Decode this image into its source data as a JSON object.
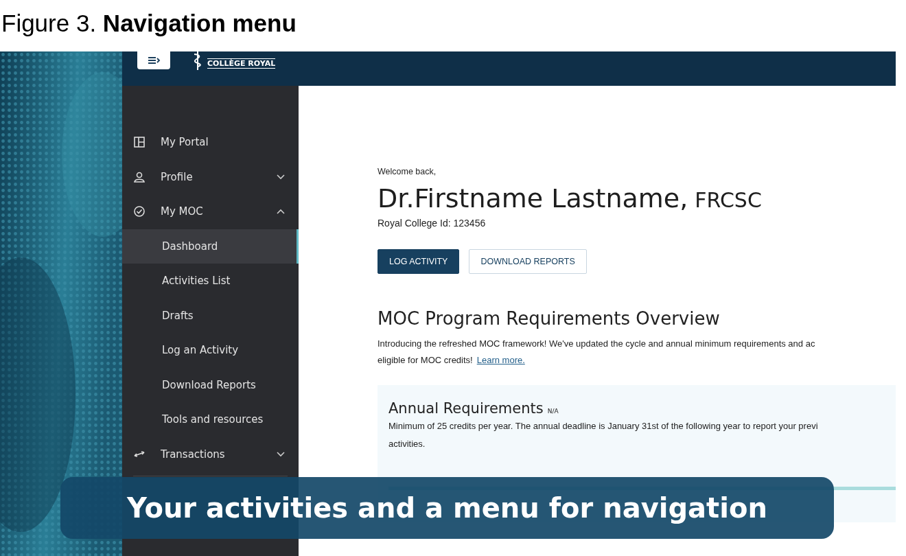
{
  "figure_caption": {
    "label": "Figure 3.",
    "title": "Navigation menu"
  },
  "header": {
    "logo_text": "COLLÈGE ROYAL"
  },
  "sidebar": {
    "items": [
      {
        "kind": "item",
        "label": "My Portal",
        "selected": false
      },
      {
        "kind": "group",
        "label": "Profile",
        "expanded": false
      },
      {
        "kind": "group",
        "label": "My MOC",
        "expanded": true,
        "children": [
          {
            "label": "Dashboard",
            "selected": true
          },
          {
            "label": "Activities List",
            "selected": false
          },
          {
            "label": "Drafts",
            "selected": false
          },
          {
            "label": "Log an Activity",
            "selected": false
          },
          {
            "label": "Download Reports",
            "selected": false
          },
          {
            "label": "Tools and resources",
            "selected": false
          }
        ]
      },
      {
        "kind": "group",
        "label": "Transactions",
        "expanded": false
      },
      {
        "kind": "divider"
      }
    ]
  },
  "main": {
    "greeting": "Welcome back,",
    "name": "Dr.Firstname Lastname,",
    "designation": "FRCSC",
    "id_line": "Royal College Id: 123456",
    "buttons": [
      {
        "label": "LOG ACTIVITY",
        "kind": "primary"
      },
      {
        "label": "DOWNLOAD REPORTS",
        "kind": "secondary"
      }
    ],
    "section_title": "MOC Program Requirements Overview",
    "intro_lines": [
      "Introducing the refreshed MOC framework! We've updated the cycle and annual minimum requirements and ac",
      "eligible for MOC credits!"
    ],
    "intro_link": "Learn more.",
    "card": {
      "title": "Annual Requirements",
      "badge": "N/A",
      "lines": [
        "Minimum of 25 credits per year. The annual deadline is January 31st of the following year to report your previ",
        "activities."
      ]
    }
  },
  "banner": {
    "text": "Your activities and a menu for navigation"
  }
}
